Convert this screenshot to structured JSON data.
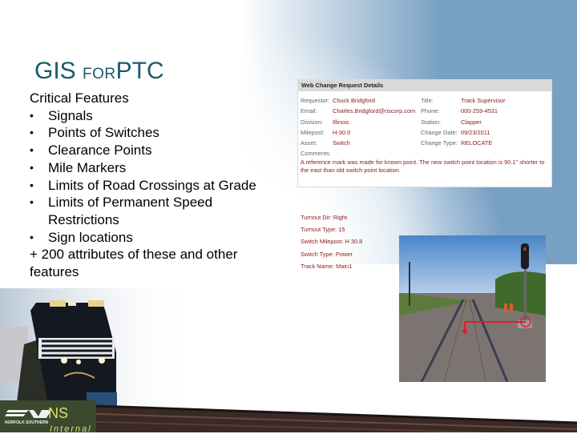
{
  "slide": {
    "title_main_1": "GIS ",
    "title_small": "FOR",
    "title_main_2": "PTC",
    "heading": "Critical Features",
    "bullets": [
      "Signals",
      "Points of Switches",
      "Clearance Points",
      "Mile Markers",
      "Limits of Road Crossings at Grade",
      "Limits of Permanent Speed Restrictions",
      "Sign locations"
    ],
    "footer_text": "+ 200 attributes of these and other features"
  },
  "request_panel": {
    "title": "Web Change Request Details",
    "rows": [
      {
        "label1": "Requestor:",
        "value1": "Chuck Bridgford",
        "label2": "Title:",
        "value2": "Track Supervisor"
      },
      {
        "label1": "Email:",
        "value1": "Charles.Bridgford@nscorp.com",
        "label2": "Phone:",
        "value2": "000-259-4531"
      },
      {
        "label1": "Division:",
        "value1": "Illinois",
        "label2": "Station:",
        "value2": "Clapper"
      },
      {
        "label1": "Milepost:",
        "value1": "H-30.0",
        "label2": "Change Date:",
        "value2": "09/23/2011"
      },
      {
        "label1": "Asset:",
        "value1": "Switch",
        "label2": "Change Type:",
        "value2": "RELOCATE"
      }
    ],
    "comments_label": "Comments:",
    "comment": "A reference mark was made for known point. The new switch point location is 90.1\" shorter to the east than old switch point location."
  },
  "switch_details": [
    {
      "label": "Turnout Dir:",
      "value": "Right"
    },
    {
      "label": "Turnout Type:",
      "value": "15"
    },
    {
      "label": "Switch Milepost:",
      "value": "H 30.8"
    },
    {
      "label": "Switch Type:",
      "value": "Power"
    },
    {
      "label": "Track Name:",
      "value": "Main1"
    }
  ],
  "branding": {
    "logo_text": "NORFOLK SOUTHERN",
    "ns_label": "NS",
    "internal_label": "Internal"
  },
  "colors": {
    "title": "#1c5a6b",
    "value_text": "#8b1a1a",
    "panel_header": "#d9d9d9",
    "ns_yellow": "#e0e060"
  }
}
